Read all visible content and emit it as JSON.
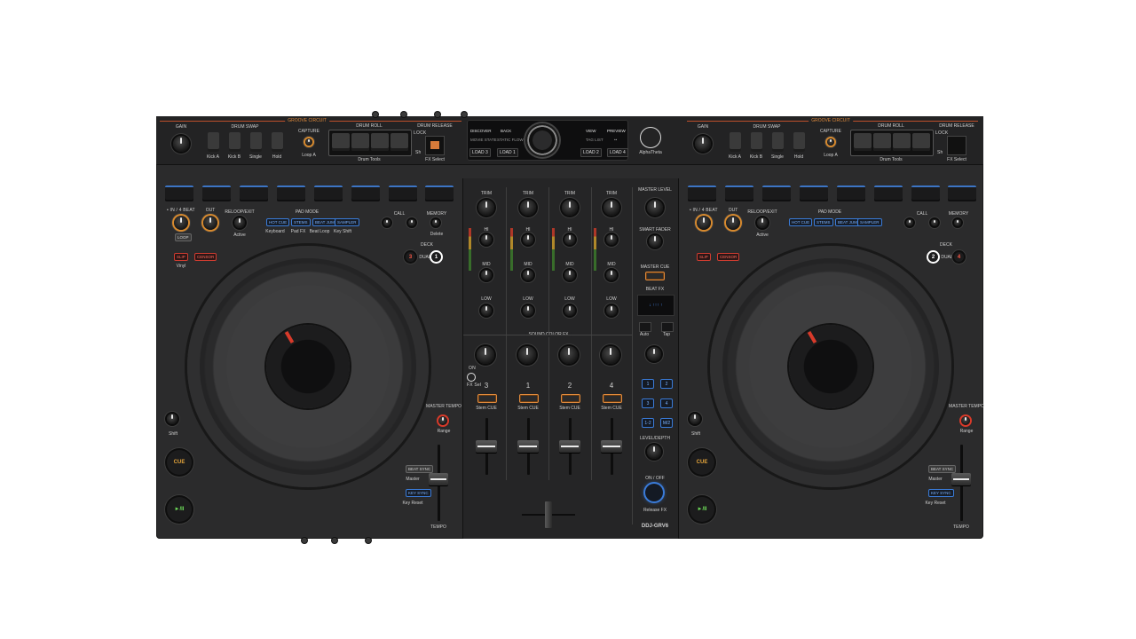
{
  "model": "DDJ-GRV6",
  "brand": "AlphaTheta",
  "top": {
    "groove_circuit": "GROOVE CIRCUIT",
    "gain": "GAIN",
    "drum_swap": "DRUM SWAP",
    "capture": "CAPTURE",
    "drum_roll": "DRUM ROLL",
    "drum_release": "DRUM RELEASE",
    "kick_a": "Kick A",
    "kick_b": "Kick B",
    "single": "Single",
    "hold": "Hold",
    "loop_a": "Loop A",
    "drum_tools": "Drum Tools",
    "lock": "LOCK",
    "fx_select": "FX Select",
    "short": "Sh"
  },
  "screen": {
    "discover": "DISCOVER",
    "back": "BACK",
    "view": "VIEW",
    "preview": "PREVIEW",
    "sub_left_1": "MOVIE STATE",
    "sub_left_2": "STATIC FLOW",
    "sub_right_1": "TAG LIST",
    "sub_right_2": "••",
    "load_left_a": "LOAD 3",
    "load_left_b": "LOAD 1",
    "load_right_a": "LOAD 2",
    "load_right_b": "LOAD 4"
  },
  "deck": {
    "in_4beat": "• IN / 4 BEAT",
    "out": "OUT",
    "reloop_exit": "RELOOP/EXIT",
    "active": "Active",
    "pad_mode": "PAD MODE",
    "hot_cue": "HOT CUE",
    "keyboard": "Keyboard",
    "stems": "STEMS",
    "pad_fx": "Pad FX",
    "beat_jump": "BEAT JUMP",
    "beat_loop": "Beat Loop",
    "sampler": "SAMPLER",
    "key_shift": "Key Shift",
    "call": "CALL",
    "memory": "MEMORY",
    "delete": "Delete",
    "loop": "LOOP",
    "deck": "DECK",
    "slip": "SLIP",
    "vinyl": "Vinyl",
    "censor": "CENSOR",
    "shift": "Shift",
    "cue": "CUE",
    "play": "►/II",
    "master_tempo": "MASTER TEMPO",
    "range": "Range",
    "beat_sync": "BEAT SYNC",
    "master": "Master",
    "key_sync": "KEY SYNC",
    "key_reset": "Key Reset",
    "tempo": "TEMPO",
    "deck_left_a": "3",
    "deck_left_b": "1",
    "deck_right_a": "2",
    "deck_right_b": "4",
    "dual": "DUAL"
  },
  "mixer": {
    "trim": "TRIM",
    "hi": "HI",
    "mid": "MID",
    "low": "LOW",
    "sound_color_fx": "SOUND COLOR FX",
    "on": "ON",
    "fx_sel": "FX Sel",
    "ch": [
      "3",
      "1",
      "2",
      "4"
    ],
    "stem_cue": "Stem CUE",
    "master_level": "MASTER LEVEL",
    "smart_fader": "SMART FADER",
    "master_cue": "MASTER CUE",
    "beat_fx": "BEAT FX",
    "beat_fx_display": "↓ ↑↑↑ ↑",
    "auto": "Auto",
    "tap": "Tap",
    "level_depth": "LEVEL/DEPTH",
    "on_off": "ON / OFF",
    "release_fx": "Release FX",
    "ch_select": [
      "1",
      "2",
      "3",
      "4",
      "1-2",
      "M/2"
    ]
  }
}
